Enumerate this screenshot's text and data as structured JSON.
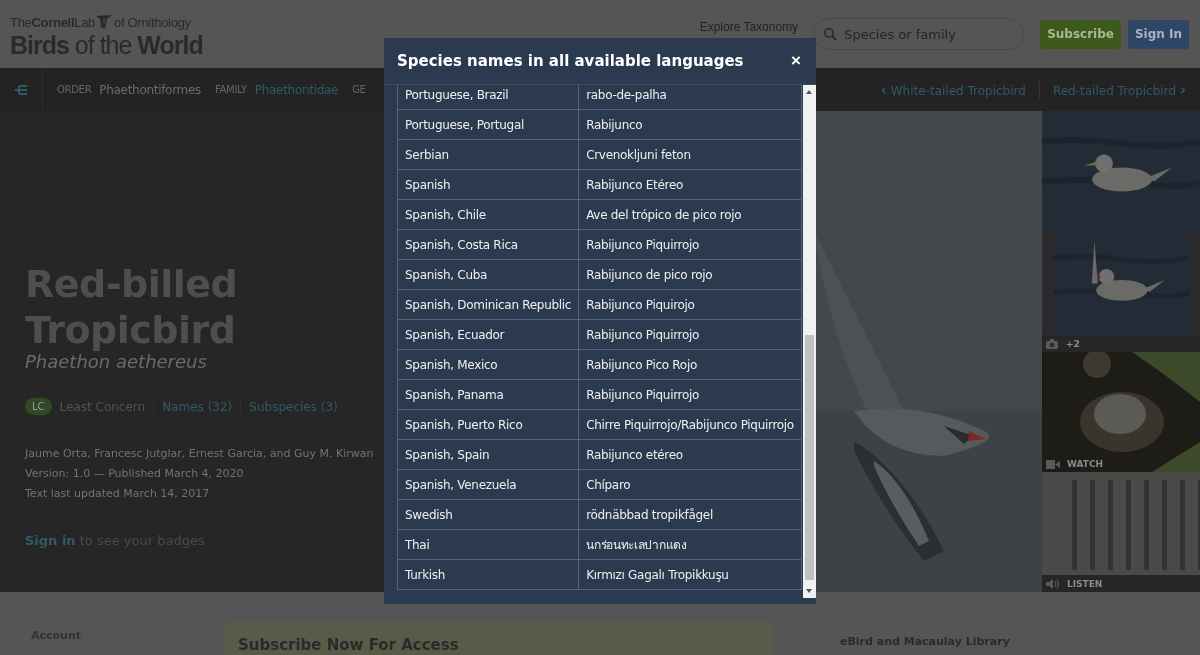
{
  "header": {
    "logo_lab": "The**Cornell**Lab",
    "logo_suffix": "of Ornithology",
    "logo_title": "**Birds** of the **World**",
    "nav_link": "Explore Taxonomy",
    "search": {
      "placeholder": "Species or family"
    },
    "buttons": [
      {
        "label": "Subscribe",
        "kind": "primary"
      },
      {
        "label": "Sign In",
        "kind": "secondary"
      }
    ]
  },
  "taxonomy_bar": {
    "items": [
      {
        "label": "ORDER",
        "value": "Phaethontiformes",
        "link": false
      },
      {
        "label": "FAMILY",
        "value": "Phaethontidae",
        "link": true
      },
      {
        "label": "GE"
      }
    ],
    "previous": "White-tailed Tropicbird",
    "next": "Red-tailed Tropicbird",
    "prev_icon": "‹",
    "next_icon": "›"
  },
  "species": {
    "name": "Red-billed Tropicbird",
    "scientific_name": "Phaethon aethereus",
    "status_code": "LC",
    "status": "Least Concern",
    "links": [
      "Names (32)",
      "Subspecies (3)"
    ],
    "authors": "Jaume Orta, Francesc Jutglar, Ernest Garcia, and Guy M. Kirwan",
    "version": "Version: 1.0 — Published March 4, 2020",
    "updated": "Text last updated March 14, 2017",
    "sign_in_link": "Sign in",
    "sign_in_text": " to see your badges"
  },
  "media": [
    {
      "count": "+2"
    },
    {
      "kind": "video",
      "label": "WATCH"
    },
    {
      "kind": "audio",
      "label": "LISTEN"
    }
  ],
  "footer": {
    "account": "Account",
    "subscribe": "Subscribe Now For Access",
    "ebird": "eBird and Macaulay Library"
  },
  "modal": {
    "title": "Species names in all available languages",
    "close": "×",
    "rows": [
      {
        "language": "Portuguese, Brazil",
        "name": "rabo-de-palha"
      },
      {
        "language": "Portuguese, Portugal",
        "name": "Rabijunco"
      },
      {
        "language": "Serbian",
        "name": "Crvenokljuni feton"
      },
      {
        "language": "Spanish",
        "name": "Rabijunco Etéreo"
      },
      {
        "language": "Spanish, Chile",
        "name": "Ave del trópico de pico rojo"
      },
      {
        "language": "Spanish, Costa Rica",
        "name": "Rabijunco Piquirrojo"
      },
      {
        "language": "Spanish, Cuba",
        "name": "Rabijunco de pico rojo"
      },
      {
        "language": "Spanish, Dominican Republic",
        "name": "Rabijunco Piquirojo"
      },
      {
        "language": "Spanish, Ecuador",
        "name": "Rabijunco Piquirrojo"
      },
      {
        "language": "Spanish, Mexico",
        "name": "Rabijunco Pico Rojo"
      },
      {
        "language": "Spanish, Panama",
        "name": "Rabijunco Piquirrojo"
      },
      {
        "language": "Spanish, Puerto Rico",
        "name": "Chirre Piquirrojo/Rabijunco Piquirrojo"
      },
      {
        "language": "Spanish, Spain",
        "name": "Rabijunco etéreo"
      },
      {
        "language": "Spanish, Venezuela",
        "name": "Chíparo"
      },
      {
        "language": "Swedish",
        "name": "rödnäbbad tropikfågel"
      },
      {
        "language": "Thai",
        "name": "นกร่อนทะเลปากแดง"
      },
      {
        "language": "Turkish",
        "name": "Kırmızı Gagalı Tropikkuşu"
      }
    ]
  }
}
